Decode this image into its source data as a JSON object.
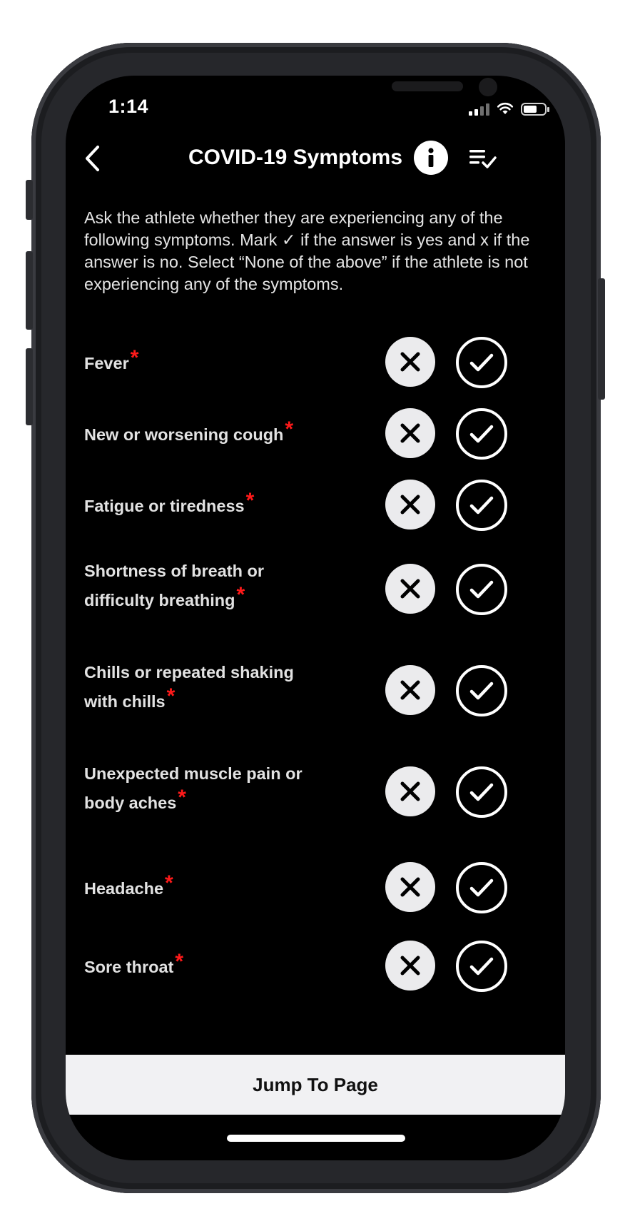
{
  "status_bar": {
    "time": "1:14",
    "signal_bars": 4,
    "signal_bars_active": 2,
    "battery_level": 0.5
  },
  "nav": {
    "title": "COVID-19 Symptoms",
    "back_icon": "chevron-left-icon",
    "info_icon": "info-icon",
    "list_icon": "list-check-icon"
  },
  "intro": "Ask the athlete whether they are experiencing any of the following symptoms. Mark ✓ if the answer is yes and x if the answer is no. Select “None of the above” if the athlete is not experiencing any of the symptoms.",
  "questions": [
    {
      "label": "Fever",
      "required": "*"
    },
    {
      "label": "New or worsening cough",
      "required": "*"
    },
    {
      "label": "Fatigue or tiredness",
      "required": "*"
    },
    {
      "label": "Shortness of breath or difficulty breathing",
      "required": "*"
    },
    {
      "label": "Chills or repeated shaking with chills",
      "required": "*"
    },
    {
      "label": "Unexpected muscle pain or body aches",
      "required": "*"
    },
    {
      "label": "Headache",
      "required": "*"
    },
    {
      "label": "Sore throat",
      "required": "*"
    }
  ],
  "footer": {
    "jump_label": "Jump To Page"
  },
  "colors": {
    "background": "#000000",
    "required": "#ff1a1a",
    "footer_bg": "#f1f1f3"
  }
}
